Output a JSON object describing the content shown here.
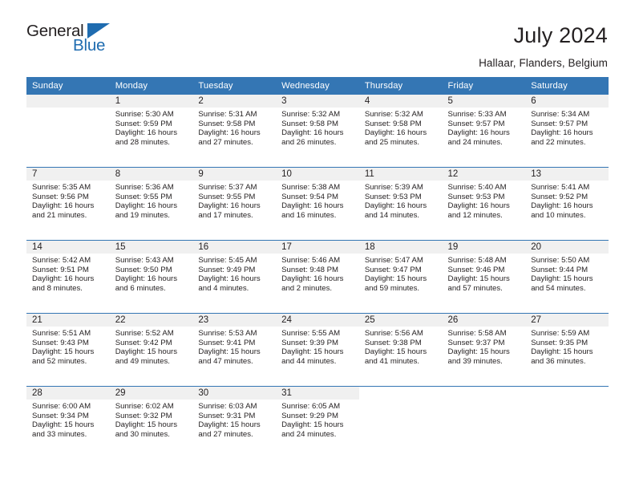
{
  "brand": {
    "name_part1": "General",
    "name_part2": "Blue",
    "accent_color": "#1f6cb0",
    "header_color": "#3476b4"
  },
  "header": {
    "title": "July 2024",
    "location": "Hallaar, Flanders, Belgium"
  },
  "calendar": {
    "weekdays": [
      "Sunday",
      "Monday",
      "Tuesday",
      "Wednesday",
      "Thursday",
      "Friday",
      "Saturday"
    ],
    "weeks": [
      [
        {
          "day": "",
          "info": ""
        },
        {
          "day": "1",
          "info": "Sunrise: 5:30 AM\nSunset: 9:59 PM\nDaylight: 16 hours\nand 28 minutes."
        },
        {
          "day": "2",
          "info": "Sunrise: 5:31 AM\nSunset: 9:58 PM\nDaylight: 16 hours\nand 27 minutes."
        },
        {
          "day": "3",
          "info": "Sunrise: 5:32 AM\nSunset: 9:58 PM\nDaylight: 16 hours\nand 26 minutes."
        },
        {
          "day": "4",
          "info": "Sunrise: 5:32 AM\nSunset: 9:58 PM\nDaylight: 16 hours\nand 25 minutes."
        },
        {
          "day": "5",
          "info": "Sunrise: 5:33 AM\nSunset: 9:57 PM\nDaylight: 16 hours\nand 24 minutes."
        },
        {
          "day": "6",
          "info": "Sunrise: 5:34 AM\nSunset: 9:57 PM\nDaylight: 16 hours\nand 22 minutes."
        }
      ],
      [
        {
          "day": "7",
          "info": "Sunrise: 5:35 AM\nSunset: 9:56 PM\nDaylight: 16 hours\nand 21 minutes."
        },
        {
          "day": "8",
          "info": "Sunrise: 5:36 AM\nSunset: 9:55 PM\nDaylight: 16 hours\nand 19 minutes."
        },
        {
          "day": "9",
          "info": "Sunrise: 5:37 AM\nSunset: 9:55 PM\nDaylight: 16 hours\nand 17 minutes."
        },
        {
          "day": "10",
          "info": "Sunrise: 5:38 AM\nSunset: 9:54 PM\nDaylight: 16 hours\nand 16 minutes."
        },
        {
          "day": "11",
          "info": "Sunrise: 5:39 AM\nSunset: 9:53 PM\nDaylight: 16 hours\nand 14 minutes."
        },
        {
          "day": "12",
          "info": "Sunrise: 5:40 AM\nSunset: 9:53 PM\nDaylight: 16 hours\nand 12 minutes."
        },
        {
          "day": "13",
          "info": "Sunrise: 5:41 AM\nSunset: 9:52 PM\nDaylight: 16 hours\nand 10 minutes."
        }
      ],
      [
        {
          "day": "14",
          "info": "Sunrise: 5:42 AM\nSunset: 9:51 PM\nDaylight: 16 hours\nand 8 minutes."
        },
        {
          "day": "15",
          "info": "Sunrise: 5:43 AM\nSunset: 9:50 PM\nDaylight: 16 hours\nand 6 minutes."
        },
        {
          "day": "16",
          "info": "Sunrise: 5:45 AM\nSunset: 9:49 PM\nDaylight: 16 hours\nand 4 minutes."
        },
        {
          "day": "17",
          "info": "Sunrise: 5:46 AM\nSunset: 9:48 PM\nDaylight: 16 hours\nand 2 minutes."
        },
        {
          "day": "18",
          "info": "Sunrise: 5:47 AM\nSunset: 9:47 PM\nDaylight: 15 hours\nand 59 minutes."
        },
        {
          "day": "19",
          "info": "Sunrise: 5:48 AM\nSunset: 9:46 PM\nDaylight: 15 hours\nand 57 minutes."
        },
        {
          "day": "20",
          "info": "Sunrise: 5:50 AM\nSunset: 9:44 PM\nDaylight: 15 hours\nand 54 minutes."
        }
      ],
      [
        {
          "day": "21",
          "info": "Sunrise: 5:51 AM\nSunset: 9:43 PM\nDaylight: 15 hours\nand 52 minutes."
        },
        {
          "day": "22",
          "info": "Sunrise: 5:52 AM\nSunset: 9:42 PM\nDaylight: 15 hours\nand 49 minutes."
        },
        {
          "day": "23",
          "info": "Sunrise: 5:53 AM\nSunset: 9:41 PM\nDaylight: 15 hours\nand 47 minutes."
        },
        {
          "day": "24",
          "info": "Sunrise: 5:55 AM\nSunset: 9:39 PM\nDaylight: 15 hours\nand 44 minutes."
        },
        {
          "day": "25",
          "info": "Sunrise: 5:56 AM\nSunset: 9:38 PM\nDaylight: 15 hours\nand 41 minutes."
        },
        {
          "day": "26",
          "info": "Sunrise: 5:58 AM\nSunset: 9:37 PM\nDaylight: 15 hours\nand 39 minutes."
        },
        {
          "day": "27",
          "info": "Sunrise: 5:59 AM\nSunset: 9:35 PM\nDaylight: 15 hours\nand 36 minutes."
        }
      ],
      [
        {
          "day": "28",
          "info": "Sunrise: 6:00 AM\nSunset: 9:34 PM\nDaylight: 15 hours\nand 33 minutes."
        },
        {
          "day": "29",
          "info": "Sunrise: 6:02 AM\nSunset: 9:32 PM\nDaylight: 15 hours\nand 30 minutes."
        },
        {
          "day": "30",
          "info": "Sunrise: 6:03 AM\nSunset: 9:31 PM\nDaylight: 15 hours\nand 27 minutes."
        },
        {
          "day": "31",
          "info": "Sunrise: 6:05 AM\nSunset: 9:29 PM\nDaylight: 15 hours\nand 24 minutes."
        },
        {
          "day": "",
          "info": ""
        },
        {
          "day": "",
          "info": ""
        },
        {
          "day": "",
          "info": ""
        }
      ]
    ]
  }
}
